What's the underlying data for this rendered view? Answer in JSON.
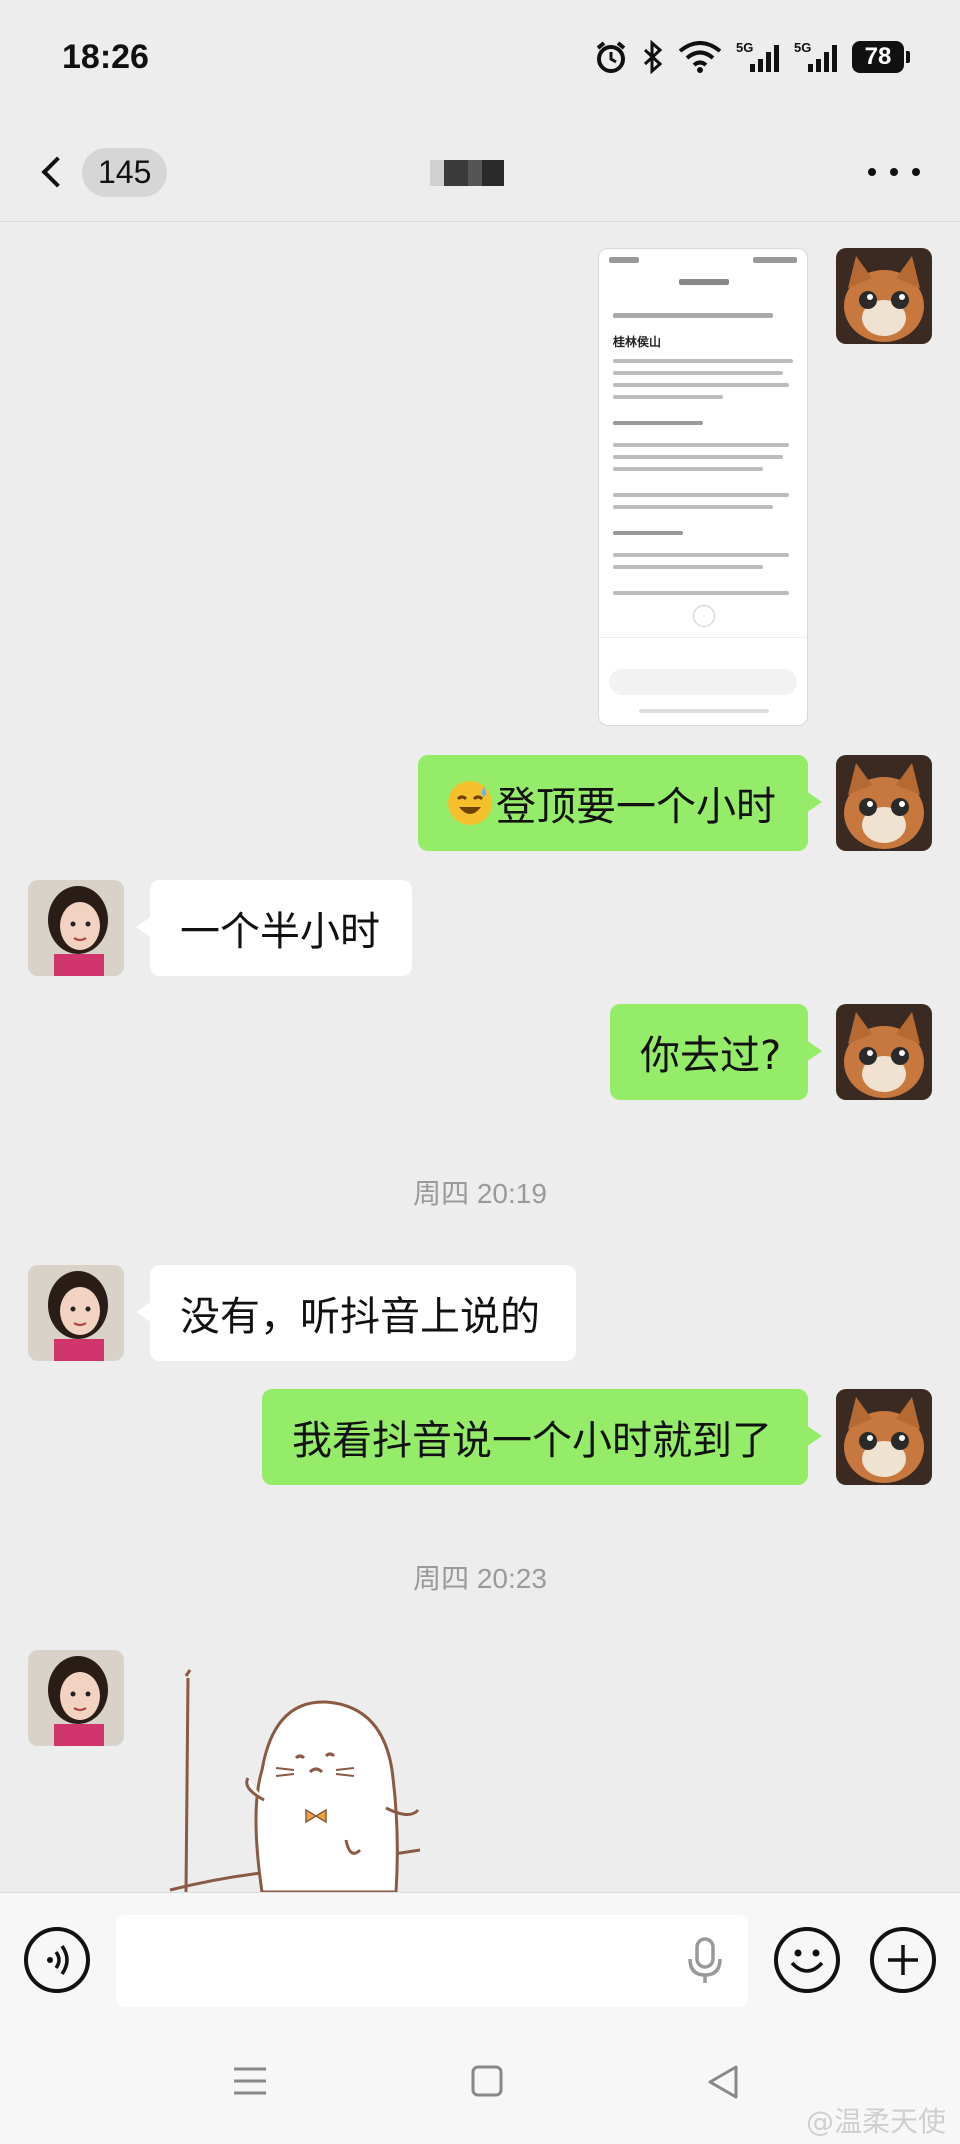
{
  "status_bar": {
    "time": "18:26",
    "signal_1_label": "5G",
    "signal_2_label": "5G",
    "battery_level": "78"
  },
  "header": {
    "unread_count": "145",
    "more_icon": "more-horizontal-icon"
  },
  "messages": [
    {
      "sender": "me",
      "type": "image",
      "image_desc_title": "桂林侯山",
      "icon": "screenshot"
    },
    {
      "sender": "me",
      "type": "text",
      "emoji": "sweat-laugh-emoji",
      "text": "登顶要一个小时"
    },
    {
      "sender": "other",
      "type": "text",
      "text": "一个半小时"
    },
    {
      "sender": "me",
      "type": "text",
      "text": "你去过?"
    },
    {
      "type": "time",
      "text": "周四 20:19"
    },
    {
      "sender": "other",
      "type": "text",
      "text": "没有，听抖音上说的"
    },
    {
      "sender": "me",
      "type": "text",
      "text": "我看抖音说一个小时就到了"
    },
    {
      "type": "time",
      "text": "周四 20:23"
    },
    {
      "sender": "other",
      "type": "sticker",
      "sticker": "seal-sticker"
    }
  ],
  "input_bar": {
    "voice_icon": "voice-input-icon",
    "mic_icon": "microphone-icon",
    "emoji_icon": "emoji-icon",
    "plus_icon": "plus-icon"
  },
  "watermark": "@温柔天使",
  "colors": {
    "my_bubble": "#95ec69",
    "other_bubble": "#ffffff",
    "background": "#ededed"
  }
}
